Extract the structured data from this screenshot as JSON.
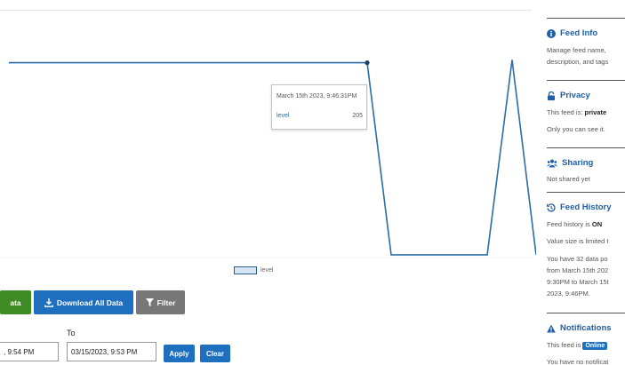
{
  "chart_data": {
    "type": "line",
    "series": [
      {
        "name": "level",
        "points_desc": "flat then drop",
        "x": [
          1,
          2,
          3,
          4,
          5,
          6,
          7,
          8,
          9,
          10,
          11,
          12,
          13
        ],
        "values": [
          205,
          205,
          205,
          205,
          205,
          205,
          205,
          1,
          1,
          1,
          1,
          208,
          1
        ]
      }
    ],
    "legend": {
      "entries": [
        "level"
      ],
      "position": "bottom"
    },
    "tooltip": {
      "date": "March 15th 2023, 9:46:31PM",
      "series": "level",
      "value": "205"
    }
  },
  "toolbar": {
    "green_label": "ata",
    "download_label": "Download All Data",
    "filter_label": "Filter"
  },
  "date_range": {
    "to_label": "To",
    "from_value": ", 9:54 PM",
    "to_value": "03/15/2023, 9:53 PM",
    "apply_label": "Apply",
    "clear_label": "Clear"
  },
  "sidebar": {
    "feed_info": {
      "title": "Feed Info",
      "line1": "Manage feed name,",
      "line2": "description, and tags"
    },
    "privacy": {
      "title": "Privacy",
      "line1_prefix": "This feed is: ",
      "line1_value": "private",
      "line2": "Only you can see it."
    },
    "sharing": {
      "title": "Sharing",
      "line1": "Not shared yet"
    },
    "history": {
      "title": "Feed History",
      "line1_prefix": "Feed history is ",
      "line1_value": "ON",
      "line2": "Value size is limited t",
      "line3": "You have 32 data po",
      "line4": "from March 15th 202",
      "line5": "9:30PM to March 15t",
      "line6": "2023, 9:46PM."
    },
    "notifications": {
      "title": "Notifications",
      "line1_prefix": "This feed is ",
      "badge": "Online",
      "line2": "You have no notificat"
    }
  }
}
